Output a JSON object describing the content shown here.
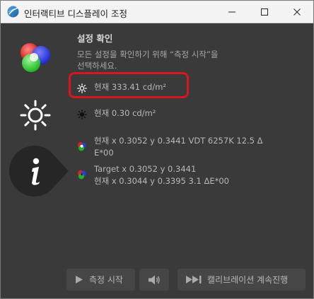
{
  "window": {
    "title": "인터랙티브 디스플레이 조정",
    "controls": [
      "minimize",
      "maximize",
      "close"
    ]
  },
  "sidebar": {
    "items": [
      {
        "name": "color",
        "icon": "rgb-circles-icon",
        "selected": false
      },
      {
        "name": "brightness",
        "icon": "sun-icon",
        "selected": false
      },
      {
        "name": "info",
        "icon": "info-icon",
        "selected": true
      }
    ]
  },
  "main": {
    "heading": "설정 확인",
    "intro_line1": "모든 설정을 확인하기 위해 “측정 시작”을",
    "intro_line2": "선택하세요.",
    "rows": {
      "white_luminance": "현재 333.41 cd/m²",
      "black_luminance": "현재 0.30 cd/m²",
      "whitepoint_line1": "현재 x 0.3052 y 0.3441 VDT 6257K 12.5 Δ",
      "whitepoint_line2": "E*00",
      "target_line1": "Target x 0.3052 y 0.3441",
      "target_line2": "현재 x 0.3044 y 0.3395 3.1 ΔE*00"
    }
  },
  "footer": {
    "measure_label": "측정 시작",
    "continue_label": "캘리브레이션 계속진행"
  },
  "colors": {
    "background": "#3a3a3a",
    "highlight": "#d9151d",
    "text": "#b8b8b8"
  }
}
